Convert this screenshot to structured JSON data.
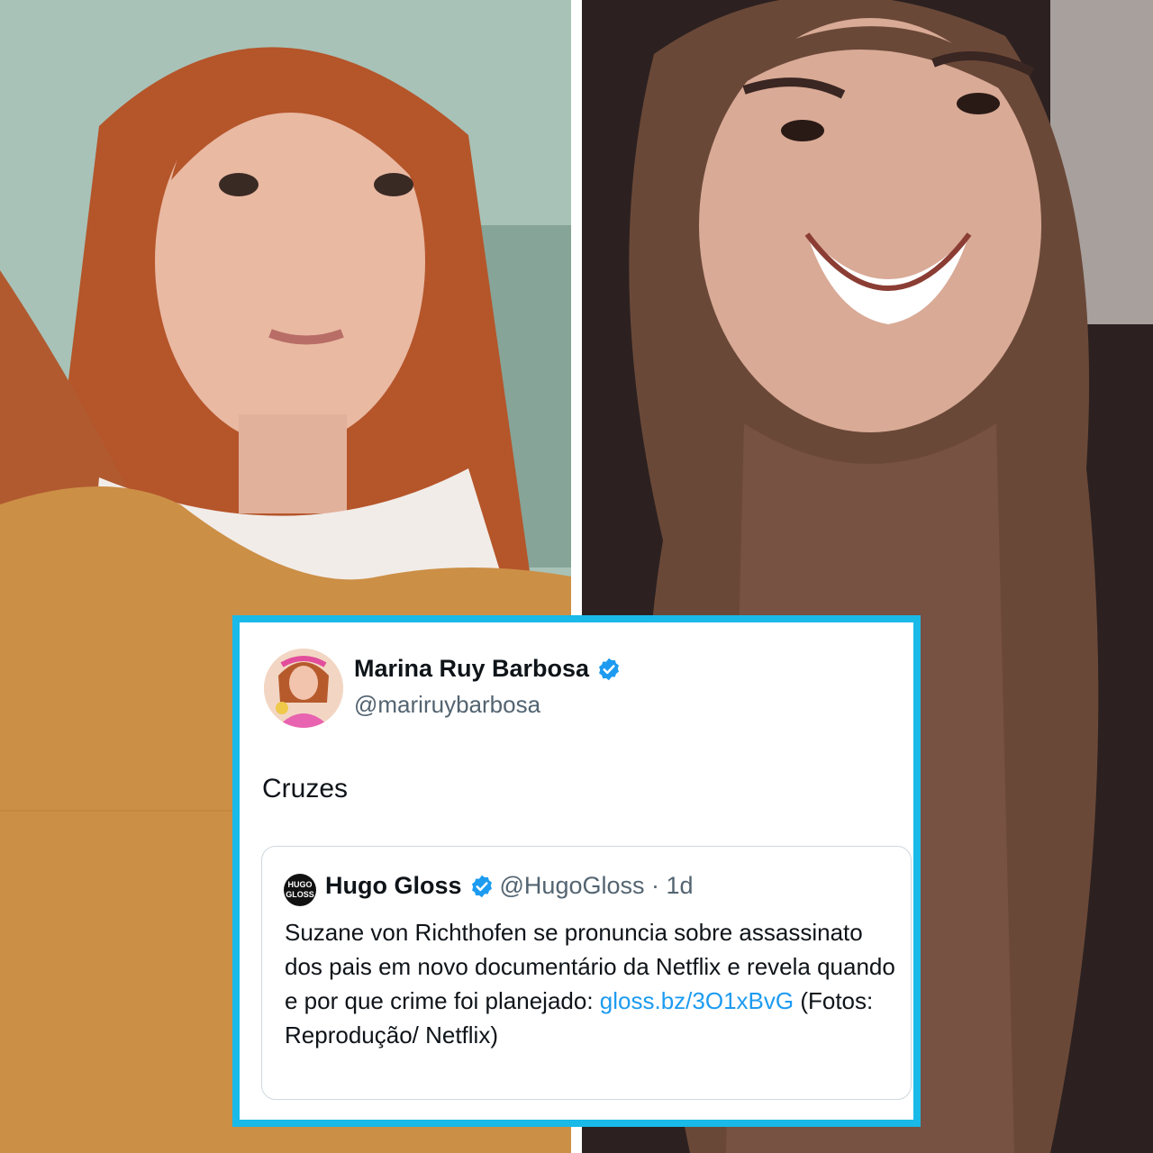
{
  "colors": {
    "card_border": "#19b9e8",
    "link": "#1d9bf0",
    "verified": "#1d9bf0",
    "secondary_text": "#536471"
  },
  "tweet": {
    "display_name": "Marina Ruy Barbosa",
    "handle": "@mariruybarbosa",
    "text": "Cruzes",
    "verified_icon": "verified-badge-icon",
    "quoted": {
      "logo_text_top": "HUGO",
      "logo_text_bottom": "GLOSS",
      "display_name": "Hugo Gloss",
      "handle": "@HugoGloss",
      "separator": " · ",
      "time": "1d",
      "text_before_link": "Suzane von Richthofen se pronuncia sobre assassinato dos pais em novo documentário da Netflix e revela quando e por que crime foi planejado: ",
      "link_text": "gloss.bz/3O1xBvG",
      "text_after_link": " (Fotos: Reprodução/ Netflix)"
    }
  }
}
